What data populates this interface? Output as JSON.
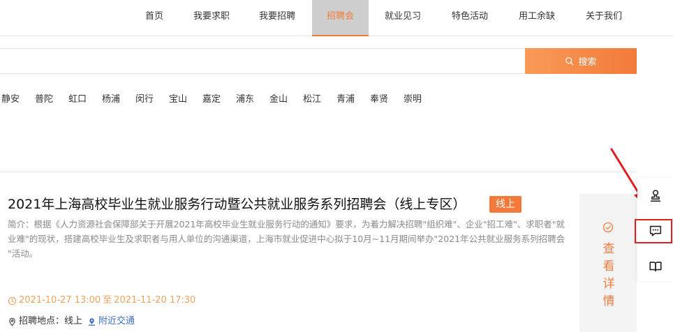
{
  "nav": {
    "items": [
      {
        "label": "首页"
      },
      {
        "label": "我要求职"
      },
      {
        "label": "我要招聘"
      },
      {
        "label": "招聘会"
      },
      {
        "label": "就业见习"
      },
      {
        "label": "特色活动"
      },
      {
        "label": "用工余缺"
      },
      {
        "label": "关于我们"
      }
    ],
    "active": "招聘会"
  },
  "search": {
    "value": "",
    "button_label": "搜索"
  },
  "districts": [
    "静安",
    "普陀",
    "虹口",
    "杨浦",
    "闵行",
    "宝山",
    "嘉定",
    "浦东",
    "金山",
    "松江",
    "青浦",
    "奉贤",
    "崇明"
  ],
  "card": {
    "title": "2021年上海高校毕业生就业服务行动暨公共就业服务系列招聘会（线上专区）",
    "badge": "线上",
    "description": "简介：根据《人力资源社会保障部关于开展2021年高校毕业生就业服务行动的通知》要求，为着力解决招聘\"组织难\"、企业\"招工难\"、求职者\"就业难\"的现状，搭建高校毕业生及求职者与用人单位的沟通渠道，上海市就业促进中心拟于10月~11月期间举办\"2021年公共就业服务系列招聘会 \"活动。",
    "start_time": "2021-10-27 13:00",
    "time_sep": "至",
    "end_time": "2021-11-20 17:30",
    "location_label": "招聘地点：线上",
    "transit_label": "附近交通",
    "detail_label": "查看详情"
  },
  "colors": {
    "accent": "#f37a3b",
    "link": "#3f6ec4",
    "highlight": "#e02020"
  },
  "float_toolbar": {
    "icons": [
      "stamp-icon",
      "chat-icon",
      "book-icon"
    ]
  }
}
